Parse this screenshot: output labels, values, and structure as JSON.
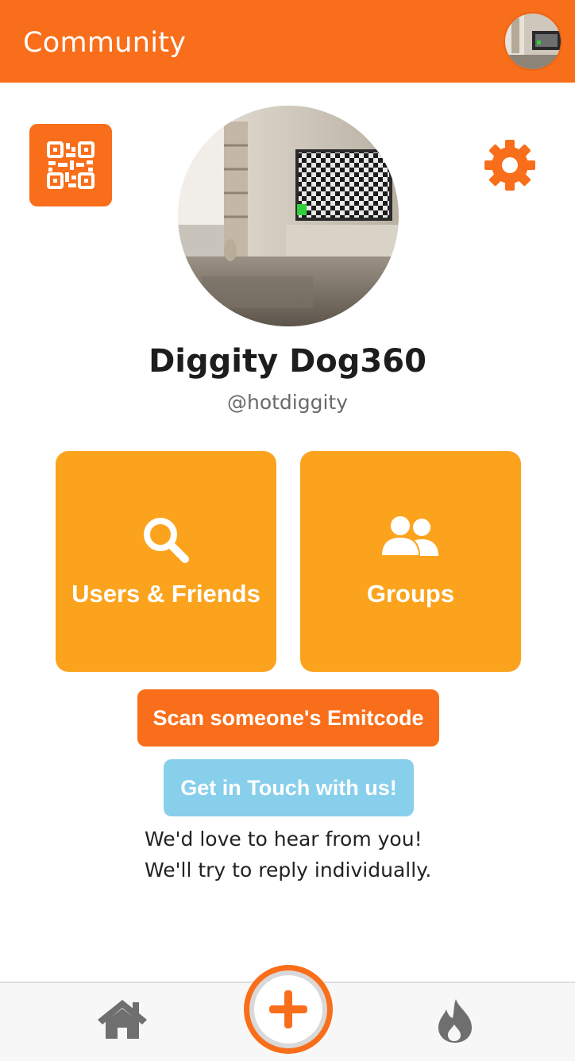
{
  "appbar": {
    "title": "Community",
    "color": "#f96e1a"
  },
  "profile": {
    "display_name": "Diggity Dog360",
    "username": "@hotdiggity"
  },
  "tiles": [
    {
      "label": "Users & Friends",
      "icon": "search-icon",
      "color": "#fca31e"
    },
    {
      "label": "Groups",
      "icon": "groups-icon",
      "color": "#fca31e"
    }
  ],
  "actions": {
    "scan_label": "Scan someone's Emitcode",
    "contact_label": "Get in Touch with us!"
  },
  "note": {
    "line1": "We'd love to hear from you!",
    "line2": "We'll try to reply individually."
  },
  "bottom_nav": [
    {
      "icon": "home-icon"
    },
    {
      "icon": "add-icon"
    },
    {
      "icon": "flame-icon"
    }
  ],
  "colors": {
    "accent": "#f96e1a",
    "tile": "#fca31e",
    "contact": "#88cfec"
  }
}
